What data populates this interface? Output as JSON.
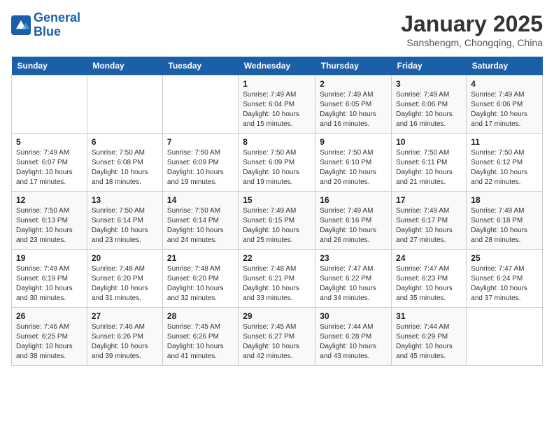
{
  "header": {
    "logo_line1": "General",
    "logo_line2": "Blue",
    "month": "January 2025",
    "location": "Sanshengm, Chongqing, China"
  },
  "days_of_week": [
    "Sunday",
    "Monday",
    "Tuesday",
    "Wednesday",
    "Thursday",
    "Friday",
    "Saturday"
  ],
  "weeks": [
    [
      {
        "day": "",
        "info": ""
      },
      {
        "day": "",
        "info": ""
      },
      {
        "day": "",
        "info": ""
      },
      {
        "day": "1",
        "info": "Sunrise: 7:49 AM\nSunset: 6:04 PM\nDaylight: 10 hours\nand 15 minutes."
      },
      {
        "day": "2",
        "info": "Sunrise: 7:49 AM\nSunset: 6:05 PM\nDaylight: 10 hours\nand 16 minutes."
      },
      {
        "day": "3",
        "info": "Sunrise: 7:49 AM\nSunset: 6:06 PM\nDaylight: 10 hours\nand 16 minutes."
      },
      {
        "day": "4",
        "info": "Sunrise: 7:49 AM\nSunset: 6:06 PM\nDaylight: 10 hours\nand 17 minutes."
      }
    ],
    [
      {
        "day": "5",
        "info": "Sunrise: 7:49 AM\nSunset: 6:07 PM\nDaylight: 10 hours\nand 17 minutes."
      },
      {
        "day": "6",
        "info": "Sunrise: 7:50 AM\nSunset: 6:08 PM\nDaylight: 10 hours\nand 18 minutes."
      },
      {
        "day": "7",
        "info": "Sunrise: 7:50 AM\nSunset: 6:09 PM\nDaylight: 10 hours\nand 19 minutes."
      },
      {
        "day": "8",
        "info": "Sunrise: 7:50 AM\nSunset: 6:09 PM\nDaylight: 10 hours\nand 19 minutes."
      },
      {
        "day": "9",
        "info": "Sunrise: 7:50 AM\nSunset: 6:10 PM\nDaylight: 10 hours\nand 20 minutes."
      },
      {
        "day": "10",
        "info": "Sunrise: 7:50 AM\nSunset: 6:11 PM\nDaylight: 10 hours\nand 21 minutes."
      },
      {
        "day": "11",
        "info": "Sunrise: 7:50 AM\nSunset: 6:12 PM\nDaylight: 10 hours\nand 22 minutes."
      }
    ],
    [
      {
        "day": "12",
        "info": "Sunrise: 7:50 AM\nSunset: 6:13 PM\nDaylight: 10 hours\nand 23 minutes."
      },
      {
        "day": "13",
        "info": "Sunrise: 7:50 AM\nSunset: 6:14 PM\nDaylight: 10 hours\nand 23 minutes."
      },
      {
        "day": "14",
        "info": "Sunrise: 7:50 AM\nSunset: 6:14 PM\nDaylight: 10 hours\nand 24 minutes."
      },
      {
        "day": "15",
        "info": "Sunrise: 7:49 AM\nSunset: 6:15 PM\nDaylight: 10 hours\nand 25 minutes."
      },
      {
        "day": "16",
        "info": "Sunrise: 7:49 AM\nSunset: 6:16 PM\nDaylight: 10 hours\nand 26 minutes."
      },
      {
        "day": "17",
        "info": "Sunrise: 7:49 AM\nSunset: 6:17 PM\nDaylight: 10 hours\nand 27 minutes."
      },
      {
        "day": "18",
        "info": "Sunrise: 7:49 AM\nSunset: 6:18 PM\nDaylight: 10 hours\nand 28 minutes."
      }
    ],
    [
      {
        "day": "19",
        "info": "Sunrise: 7:49 AM\nSunset: 6:19 PM\nDaylight: 10 hours\nand 30 minutes."
      },
      {
        "day": "20",
        "info": "Sunrise: 7:48 AM\nSunset: 6:20 PM\nDaylight: 10 hours\nand 31 minutes."
      },
      {
        "day": "21",
        "info": "Sunrise: 7:48 AM\nSunset: 6:20 PM\nDaylight: 10 hours\nand 32 minutes."
      },
      {
        "day": "22",
        "info": "Sunrise: 7:48 AM\nSunset: 6:21 PM\nDaylight: 10 hours\nand 33 minutes."
      },
      {
        "day": "23",
        "info": "Sunrise: 7:47 AM\nSunset: 6:22 PM\nDaylight: 10 hours\nand 34 minutes."
      },
      {
        "day": "24",
        "info": "Sunrise: 7:47 AM\nSunset: 6:23 PM\nDaylight: 10 hours\nand 35 minutes."
      },
      {
        "day": "25",
        "info": "Sunrise: 7:47 AM\nSunset: 6:24 PM\nDaylight: 10 hours\nand 37 minutes."
      }
    ],
    [
      {
        "day": "26",
        "info": "Sunrise: 7:46 AM\nSunset: 6:25 PM\nDaylight: 10 hours\nand 38 minutes."
      },
      {
        "day": "27",
        "info": "Sunrise: 7:46 AM\nSunset: 6:26 PM\nDaylight: 10 hours\nand 39 minutes."
      },
      {
        "day": "28",
        "info": "Sunrise: 7:45 AM\nSunset: 6:26 PM\nDaylight: 10 hours\nand 41 minutes."
      },
      {
        "day": "29",
        "info": "Sunrise: 7:45 AM\nSunset: 6:27 PM\nDaylight: 10 hours\nand 42 minutes."
      },
      {
        "day": "30",
        "info": "Sunrise: 7:44 AM\nSunset: 6:28 PM\nDaylight: 10 hours\nand 43 minutes."
      },
      {
        "day": "31",
        "info": "Sunrise: 7:44 AM\nSunset: 6:29 PM\nDaylight: 10 hours\nand 45 minutes."
      },
      {
        "day": "",
        "info": ""
      }
    ]
  ]
}
